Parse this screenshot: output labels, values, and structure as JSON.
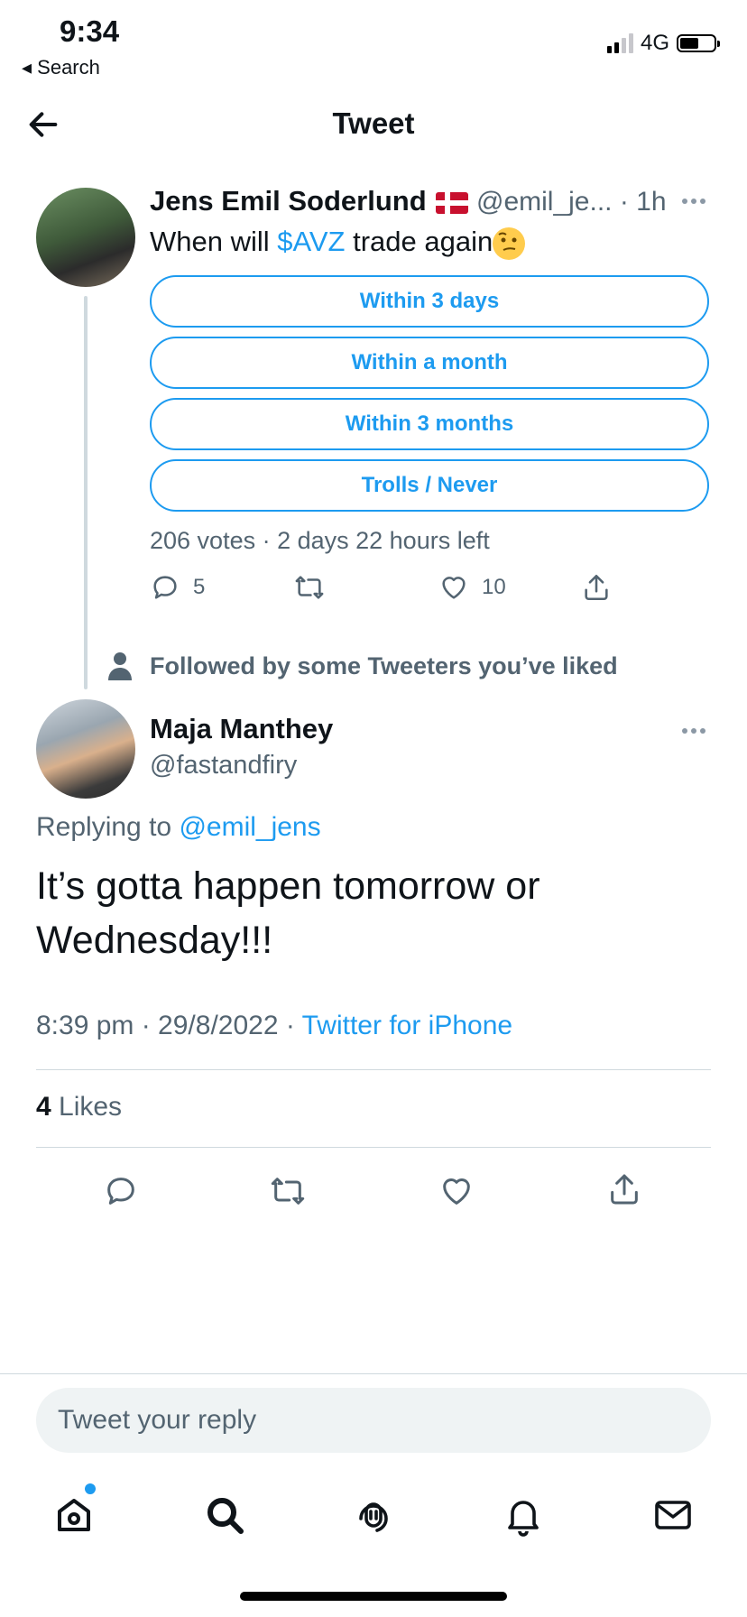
{
  "status_bar": {
    "time": "9:34",
    "back_label": "◂ Search",
    "network": "4G"
  },
  "header": {
    "title": "Tweet"
  },
  "tweet1": {
    "name": "Jens Emil Soderlund",
    "handle_time": "@emil_je... · 1h",
    "text_prefix": "When will ",
    "cashtag": "$AVZ",
    "text_suffix": " trade again",
    "poll": {
      "options": [
        "Within 3 days",
        "Within a month",
        "Within 3 months",
        "Trolls / Never"
      ],
      "meta": "206 votes · 2 days 22 hours left"
    },
    "actions": {
      "replies": "5",
      "retweets": "",
      "likes": "10"
    }
  },
  "social_context": {
    "text": "Followed by some Tweeters you’ve liked"
  },
  "tweet2": {
    "name": "Maja Manthey",
    "handle": "@fastandfiry",
    "replying_prefix": "Replying to ",
    "replying_to": "@emil_jens",
    "text": "It’s gotta happen tomorrow or Wednesday!!!",
    "time_date": "8:39 pm · 29/8/2022 · ",
    "source": "Twitter for iPhone",
    "likes_count": "4",
    "likes_label": " Likes"
  },
  "reply_box": {
    "placeholder": "Tweet your reply"
  },
  "tabbar": {
    "items": [
      "home-icon",
      "search-icon",
      "spaces-icon",
      "notifications-icon",
      "messages-icon"
    ]
  },
  "colors": {
    "accent": "#1d9bf0",
    "secondary_text": "#536471",
    "divider": "#cfd9de"
  }
}
